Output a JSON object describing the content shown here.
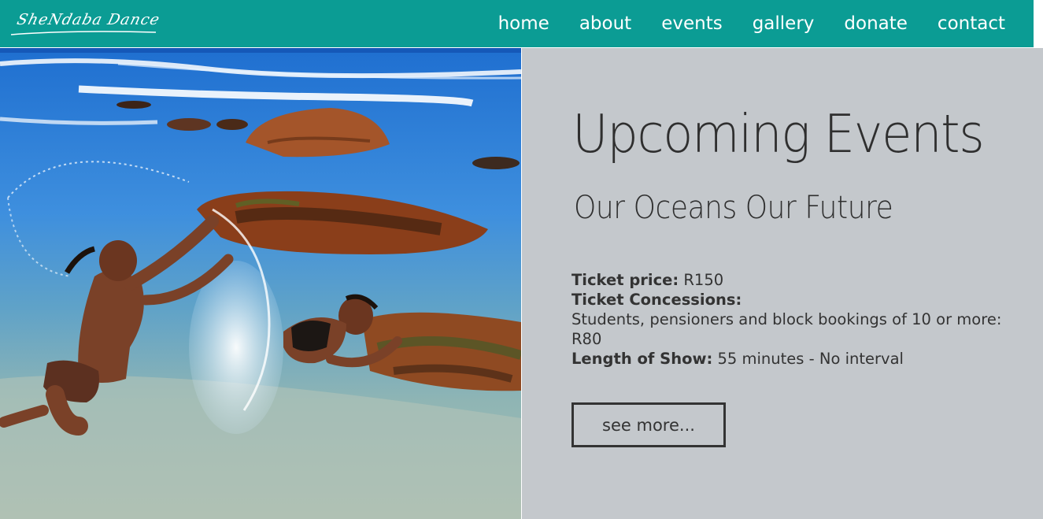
{
  "brand": {
    "logo_text": "SheNdaba Dance",
    "color_primary": "#0b9c94",
    "panel_bg": "#c4c8cc",
    "text_color": "#333333"
  },
  "nav": {
    "items": [
      {
        "label": "home"
      },
      {
        "label": "about"
      },
      {
        "label": "events"
      },
      {
        "label": "gallery"
      },
      {
        "label": "donate"
      },
      {
        "label": "contact"
      }
    ]
  },
  "hero": {
    "image_subject": "two dancers splashing water among rocks in a tidal ocean pool"
  },
  "events": {
    "title": "Upcoming Events",
    "event_name": "Our Oceans Our Future",
    "ticket_price_label": "Ticket price:",
    "ticket_price_value": " R150",
    "concessions_label": "Ticket Concessions:",
    "concessions_text": "Students, pensioners and block bookings of 10 or more: R80",
    "length_label": "Length of Show:",
    "length_value": " 55 minutes - No interval",
    "see_more_label": "see more..."
  }
}
